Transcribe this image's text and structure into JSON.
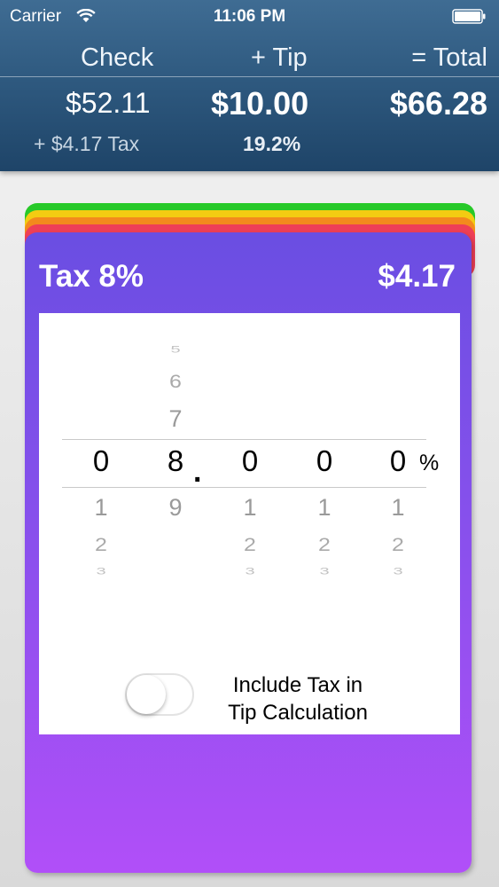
{
  "status_bar": {
    "carrier": "Carrier",
    "time": "11:06 PM"
  },
  "summary": {
    "check_label": "Check",
    "tip_label": "+ Tip",
    "total_label": "= Total",
    "check_amount": "$52.11",
    "tip_amount": "$10.00",
    "total_amount": "$66.28",
    "tax_note": "+ $4.17 Tax",
    "tip_percent": "19.2%"
  },
  "card_tabs": [
    {
      "name": "green",
      "color": "#27c928"
    },
    {
      "name": "yellow",
      "color": "#f3cc12"
    },
    {
      "name": "orange",
      "color": "#f38a1d"
    },
    {
      "name": "red",
      "color": "#ee3f57"
    }
  ],
  "tax_card": {
    "title": "Tax  8%",
    "amount": "$4.17",
    "picker": {
      "columns": [
        {
          "above": [
            "",
            "",
            ""
          ],
          "selected": "0",
          "below": [
            "1",
            "2",
            "3"
          ]
        },
        {
          "above": [
            "5",
            "6",
            "7"
          ],
          "selected": "8",
          "below": [
            "9",
            "",
            ""
          ]
        },
        {
          "above": [
            "",
            "",
            ""
          ],
          "selected": "0",
          "below": [
            "1",
            "2",
            "3"
          ]
        },
        {
          "above": [
            "",
            "",
            ""
          ],
          "selected": "0",
          "below": [
            "1",
            "2",
            "3"
          ]
        },
        {
          "above": [
            "",
            "",
            ""
          ],
          "selected": "0",
          "below": [
            "1",
            "2",
            "3"
          ]
        }
      ],
      "decimal": ".",
      "unit": "%"
    },
    "toggle": {
      "label_line1": "Include Tax in",
      "label_line2": "Tip Calculation",
      "on": false
    }
  },
  "colors": {
    "header_bg": "#2f5a80",
    "card_top": "#6a4ee2",
    "card_bottom": "#b14ff8"
  }
}
